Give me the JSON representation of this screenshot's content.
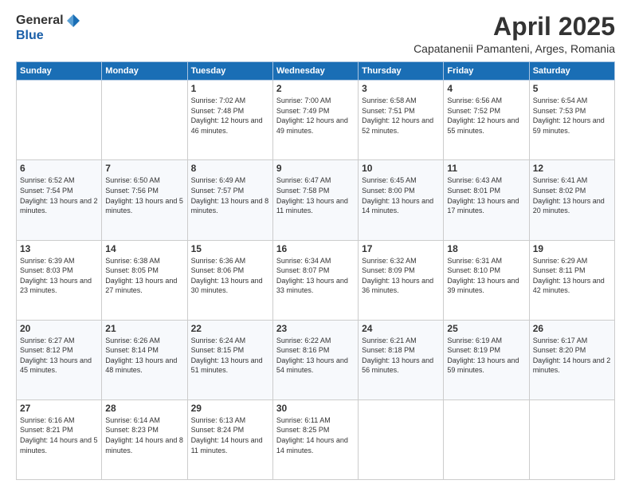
{
  "logo": {
    "general": "General",
    "blue": "Blue"
  },
  "title": "April 2025",
  "subtitle": "Capatanenii Pamanteni, Arges, Romania",
  "weekdays": [
    "Sunday",
    "Monday",
    "Tuesday",
    "Wednesday",
    "Thursday",
    "Friday",
    "Saturday"
  ],
  "weeks": [
    [
      {
        "day": "",
        "info": ""
      },
      {
        "day": "",
        "info": ""
      },
      {
        "day": "1",
        "info": "Sunrise: 7:02 AM\nSunset: 7:48 PM\nDaylight: 12 hours and 46 minutes."
      },
      {
        "day": "2",
        "info": "Sunrise: 7:00 AM\nSunset: 7:49 PM\nDaylight: 12 hours and 49 minutes."
      },
      {
        "day": "3",
        "info": "Sunrise: 6:58 AM\nSunset: 7:51 PM\nDaylight: 12 hours and 52 minutes."
      },
      {
        "day": "4",
        "info": "Sunrise: 6:56 AM\nSunset: 7:52 PM\nDaylight: 12 hours and 55 minutes."
      },
      {
        "day": "5",
        "info": "Sunrise: 6:54 AM\nSunset: 7:53 PM\nDaylight: 12 hours and 59 minutes."
      }
    ],
    [
      {
        "day": "6",
        "info": "Sunrise: 6:52 AM\nSunset: 7:54 PM\nDaylight: 13 hours and 2 minutes."
      },
      {
        "day": "7",
        "info": "Sunrise: 6:50 AM\nSunset: 7:56 PM\nDaylight: 13 hours and 5 minutes."
      },
      {
        "day": "8",
        "info": "Sunrise: 6:49 AM\nSunset: 7:57 PM\nDaylight: 13 hours and 8 minutes."
      },
      {
        "day": "9",
        "info": "Sunrise: 6:47 AM\nSunset: 7:58 PM\nDaylight: 13 hours and 11 minutes."
      },
      {
        "day": "10",
        "info": "Sunrise: 6:45 AM\nSunset: 8:00 PM\nDaylight: 13 hours and 14 minutes."
      },
      {
        "day": "11",
        "info": "Sunrise: 6:43 AM\nSunset: 8:01 PM\nDaylight: 13 hours and 17 minutes."
      },
      {
        "day": "12",
        "info": "Sunrise: 6:41 AM\nSunset: 8:02 PM\nDaylight: 13 hours and 20 minutes."
      }
    ],
    [
      {
        "day": "13",
        "info": "Sunrise: 6:39 AM\nSunset: 8:03 PM\nDaylight: 13 hours and 23 minutes."
      },
      {
        "day": "14",
        "info": "Sunrise: 6:38 AM\nSunset: 8:05 PM\nDaylight: 13 hours and 27 minutes."
      },
      {
        "day": "15",
        "info": "Sunrise: 6:36 AM\nSunset: 8:06 PM\nDaylight: 13 hours and 30 minutes."
      },
      {
        "day": "16",
        "info": "Sunrise: 6:34 AM\nSunset: 8:07 PM\nDaylight: 13 hours and 33 minutes."
      },
      {
        "day": "17",
        "info": "Sunrise: 6:32 AM\nSunset: 8:09 PM\nDaylight: 13 hours and 36 minutes."
      },
      {
        "day": "18",
        "info": "Sunrise: 6:31 AM\nSunset: 8:10 PM\nDaylight: 13 hours and 39 minutes."
      },
      {
        "day": "19",
        "info": "Sunrise: 6:29 AM\nSunset: 8:11 PM\nDaylight: 13 hours and 42 minutes."
      }
    ],
    [
      {
        "day": "20",
        "info": "Sunrise: 6:27 AM\nSunset: 8:12 PM\nDaylight: 13 hours and 45 minutes."
      },
      {
        "day": "21",
        "info": "Sunrise: 6:26 AM\nSunset: 8:14 PM\nDaylight: 13 hours and 48 minutes."
      },
      {
        "day": "22",
        "info": "Sunrise: 6:24 AM\nSunset: 8:15 PM\nDaylight: 13 hours and 51 minutes."
      },
      {
        "day": "23",
        "info": "Sunrise: 6:22 AM\nSunset: 8:16 PM\nDaylight: 13 hours and 54 minutes."
      },
      {
        "day": "24",
        "info": "Sunrise: 6:21 AM\nSunset: 8:18 PM\nDaylight: 13 hours and 56 minutes."
      },
      {
        "day": "25",
        "info": "Sunrise: 6:19 AM\nSunset: 8:19 PM\nDaylight: 13 hours and 59 minutes."
      },
      {
        "day": "26",
        "info": "Sunrise: 6:17 AM\nSunset: 8:20 PM\nDaylight: 14 hours and 2 minutes."
      }
    ],
    [
      {
        "day": "27",
        "info": "Sunrise: 6:16 AM\nSunset: 8:21 PM\nDaylight: 14 hours and 5 minutes."
      },
      {
        "day": "28",
        "info": "Sunrise: 6:14 AM\nSunset: 8:23 PM\nDaylight: 14 hours and 8 minutes."
      },
      {
        "day": "29",
        "info": "Sunrise: 6:13 AM\nSunset: 8:24 PM\nDaylight: 14 hours and 11 minutes."
      },
      {
        "day": "30",
        "info": "Sunrise: 6:11 AM\nSunset: 8:25 PM\nDaylight: 14 hours and 14 minutes."
      },
      {
        "day": "",
        "info": ""
      },
      {
        "day": "",
        "info": ""
      },
      {
        "day": "",
        "info": ""
      }
    ]
  ]
}
